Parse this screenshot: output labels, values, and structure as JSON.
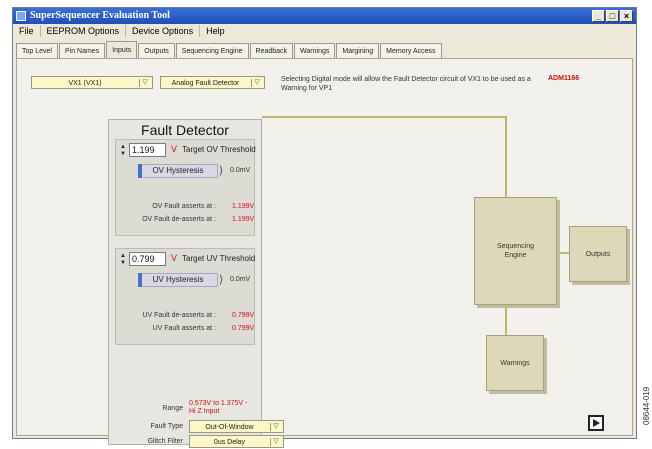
{
  "window": {
    "title": "SuperSequencer Evaluation Tool"
  },
  "menu": [
    "File",
    "EEPROM Options",
    "Device Options",
    "Help"
  ],
  "tabs": [
    {
      "label": "Top Level"
    },
    {
      "label": "Pin Names"
    },
    {
      "label": "Inputs",
      "active": true
    },
    {
      "label": "Outputs"
    },
    {
      "label": "Sequencing Engine"
    },
    {
      "label": "Readback"
    },
    {
      "label": "Warnings"
    },
    {
      "label": "Margining"
    },
    {
      "label": "Memory Access"
    }
  ],
  "inputs": {
    "channel_select": "VX1  (VX1)",
    "detector_select": "Analog Fault Detector",
    "info": "Selecting Digital mode will allow the Fault Detector circuit of VX1 to be used as a Warning for VP1",
    "device": "ADM1166"
  },
  "fault_detector": {
    "title": "Fault Detector",
    "ov": {
      "value": "1.199",
      "unit": "V",
      "label": "Target OV Threshold",
      "hysteresis_label": "OV Hysteresis",
      "hysteresis_value": "0.0mV",
      "asserts_label": "OV Fault asserts at :",
      "asserts_value": "1.199V",
      "deasserts_label": "OV Fault de-asserts at :",
      "deasserts_value": "1.199V"
    },
    "uv": {
      "value": "0.799",
      "unit": "V",
      "label": "Target UV Threshold",
      "hysteresis_label": "UV Hysteresis",
      "hysteresis_value": "0.0mV",
      "deasserts_label": "UV Fault de-asserts at :",
      "deasserts_value": "0.799V",
      "asserts_label": "UV Fault asserts at :",
      "asserts_value": "0.799V"
    },
    "range_label": "Range",
    "range_value_line1": "0.573V to 1.375V -",
    "range_value_line2": "Hi Z Input",
    "fault_type_label": "Fault Type",
    "fault_type_value": "Out-Of-Window",
    "glitch_filter_label": "Glitch Filter",
    "glitch_filter_value": "0us Delay"
  },
  "diagram": {
    "sequencing_engine_line1": "Sequencing",
    "sequencing_engine_line2": "Engine",
    "outputs": "Outputs",
    "warnings": "Warnings"
  },
  "figure_id": "08644-019",
  "colors": {
    "accent_red": "#d01010",
    "block_fill": "#ddd9b8",
    "combo_fill": "#fbf7c6"
  }
}
